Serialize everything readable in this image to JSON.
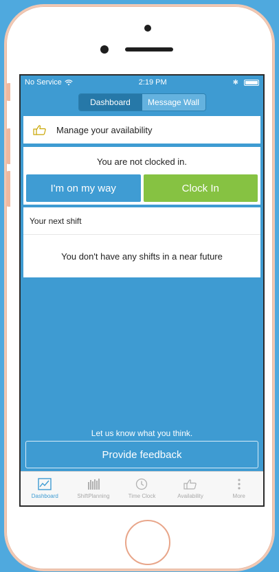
{
  "statusbar": {
    "carrier": "No Service",
    "time": "2:19 PM"
  },
  "segment": {
    "dashboard": "Dashboard",
    "message_wall": "Message Wall"
  },
  "availability": {
    "label": "Manage your availability"
  },
  "clock": {
    "status": "You are not clocked in.",
    "on_my_way": "I'm on my way",
    "clock_in": "Clock In"
  },
  "shift": {
    "title": "Your next shift",
    "empty": "You don't have any shifts in a near future"
  },
  "feedback": {
    "prompt": "Let us know what you think.",
    "button": "Provide feedback"
  },
  "tabs": [
    {
      "label": "Dashboard",
      "icon": "dashboard-chart-icon"
    },
    {
      "label": "ShiftPlanning",
      "icon": "shift-planning-icon"
    },
    {
      "label": "Time Clock",
      "icon": "clock-icon"
    },
    {
      "label": "Availability",
      "icon": "thumbs-up-icon"
    },
    {
      "label": "More",
      "icon": "more-dots-icon"
    }
  ],
  "colors": {
    "brand_blue": "#3e9bd2",
    "clock_in_green": "#86c242",
    "background": "#4fa9de"
  }
}
